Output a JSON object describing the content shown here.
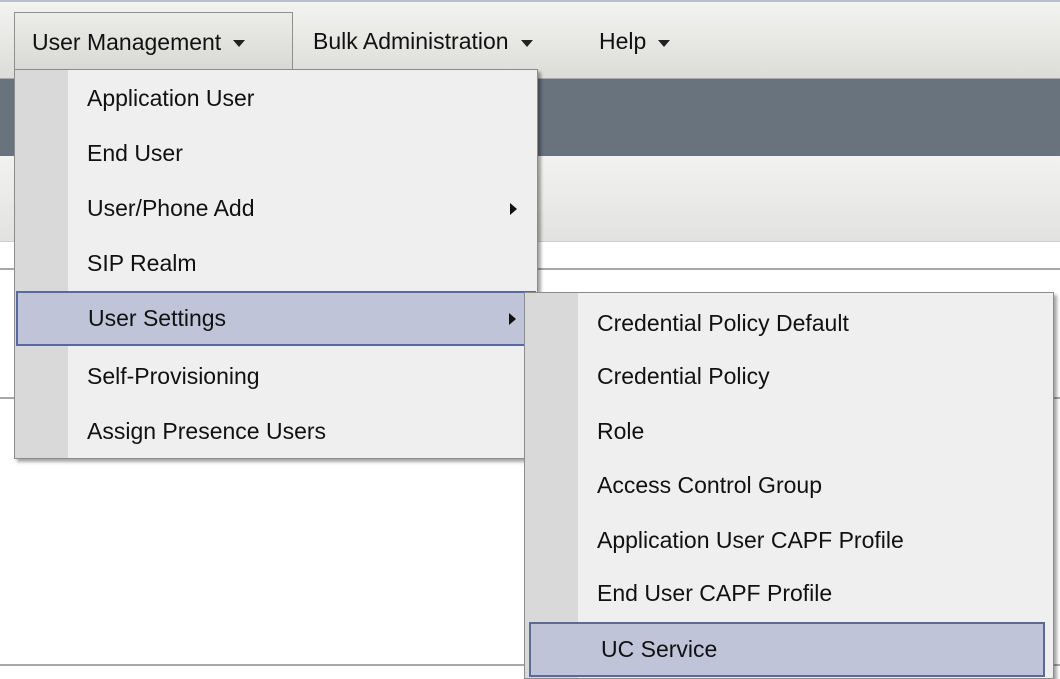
{
  "menubar": {
    "items": [
      {
        "label": "User Management"
      },
      {
        "label": "Bulk Administration"
      },
      {
        "label": "Help"
      }
    ]
  },
  "user_management_menu": {
    "items": [
      {
        "label": "Application User"
      },
      {
        "label": "End User"
      },
      {
        "label": "User/Phone Add"
      },
      {
        "label": "SIP Realm"
      },
      {
        "label": "User Settings"
      },
      {
        "label": "Self-Provisioning"
      },
      {
        "label": "Assign Presence Users"
      }
    ]
  },
  "user_settings_submenu": {
    "items": [
      {
        "label": "Credential Policy Default"
      },
      {
        "label": "Credential Policy"
      },
      {
        "label": "Role"
      },
      {
        "label": "Access Control Group"
      },
      {
        "label": "Application User CAPF Profile"
      },
      {
        "label": "End User CAPF Profile"
      },
      {
        "label": "UC Service"
      }
    ]
  },
  "colors": {
    "header_band": "#68737e",
    "highlight_fill": "#c0c4d8",
    "highlight_border": "#5c6898"
  }
}
